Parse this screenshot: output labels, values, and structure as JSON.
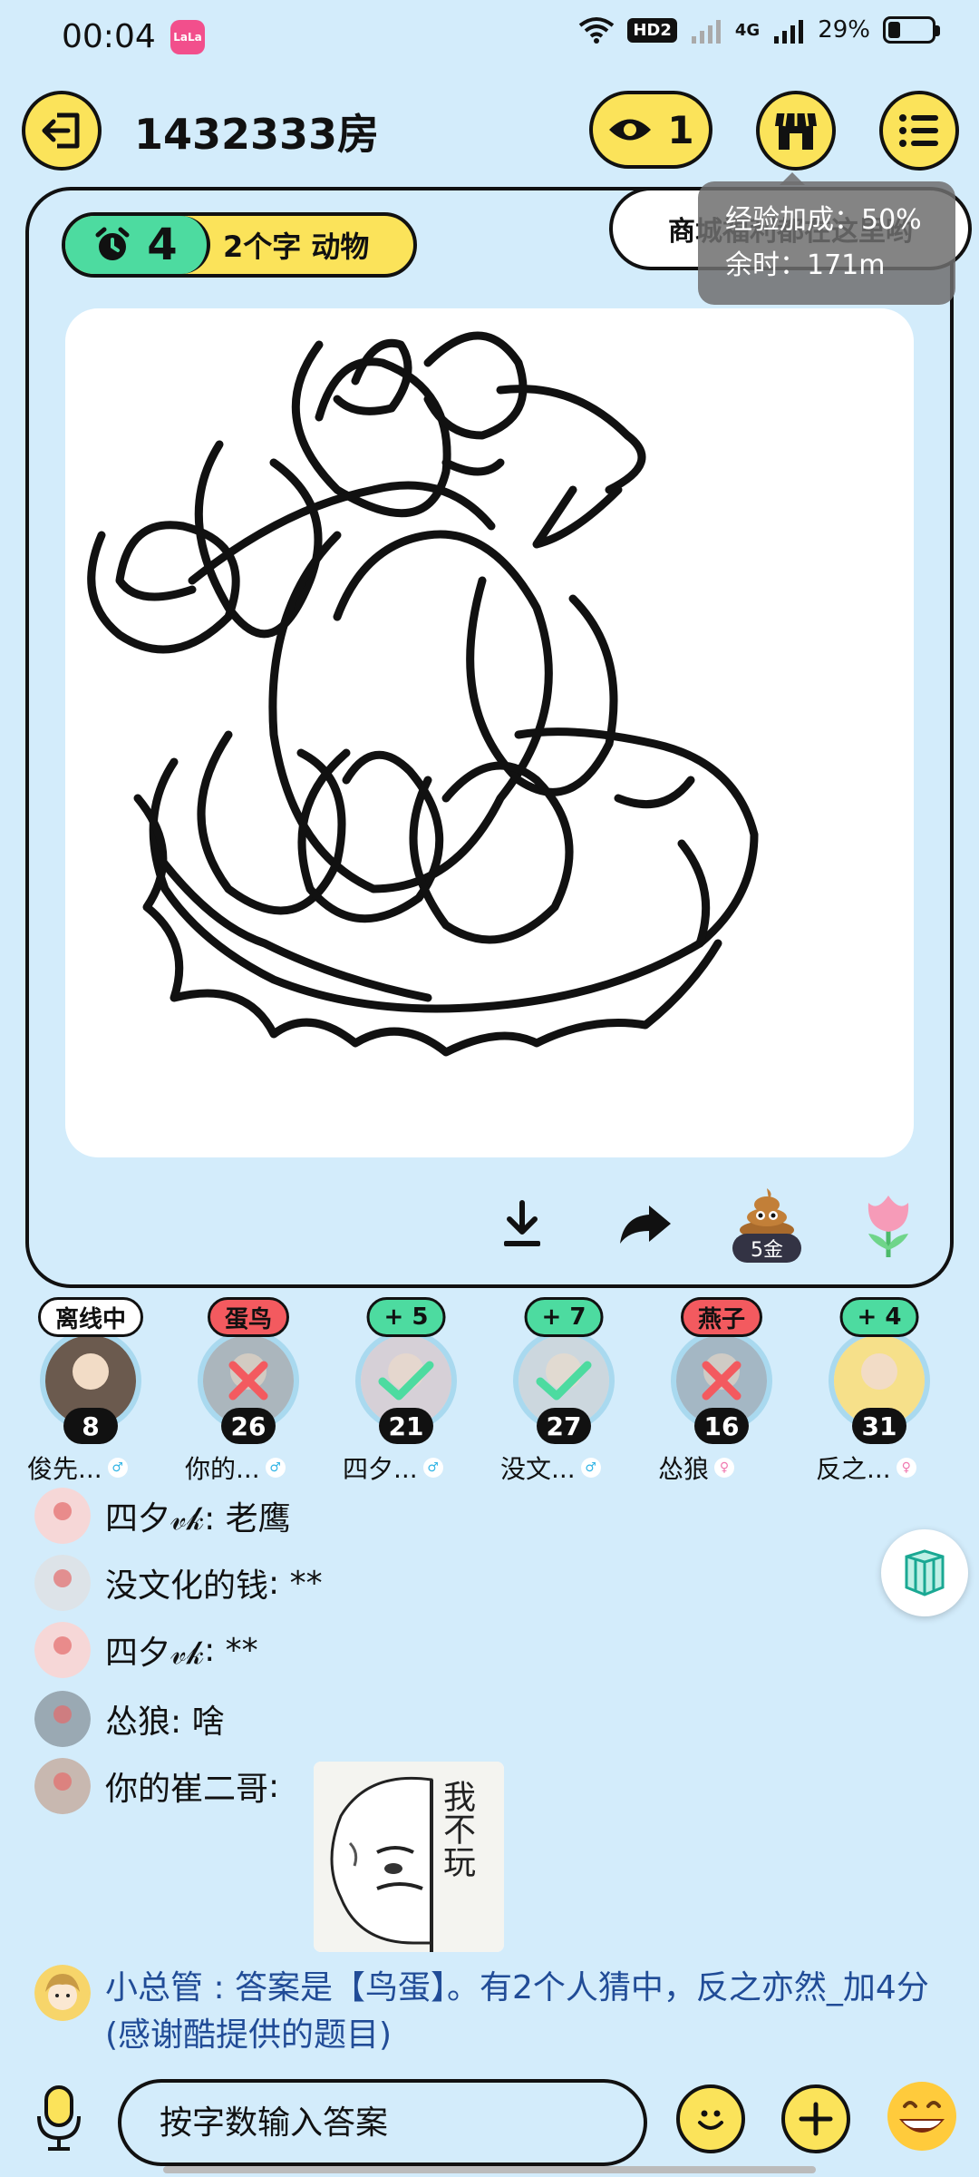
{
  "status": {
    "time": "00:04",
    "app_icon_text": "LaLa",
    "hd": "HD2",
    "network": "4G",
    "battery": "29%",
    "battery_level": 0.29
  },
  "header": {
    "room_title": "1432333房",
    "viewer_count": "1"
  },
  "game": {
    "timer": "4",
    "hint": "2个字 动物",
    "tip_bubble": "商城福利都在这里哟",
    "tooltip_line1": "经验加成：50%",
    "tooltip_line2": "余时：171m",
    "poop_cost": "5金"
  },
  "players": [
    {
      "badge": "离线中",
      "badge_type": "offline",
      "score": "8",
      "name": "俊先...",
      "gender": "male",
      "mark": "none",
      "avatar_color": "#6b5a4e"
    },
    {
      "badge": "蛋鸟",
      "badge_type": "red",
      "score": "26",
      "name": "你的...",
      "gender": "male",
      "mark": "wrong",
      "avatar_color": "#8a8a8a"
    },
    {
      "badge": "+ 5",
      "badge_type": "green",
      "score": "21",
      "name": "四夕...",
      "gender": "male",
      "mark": "correct",
      "avatar_color": "#d9b9b9"
    },
    {
      "badge": "+ 7",
      "badge_type": "green",
      "score": "27",
      "name": "没文...",
      "gender": "male",
      "mark": "correct",
      "avatar_color": "#c6c6c6"
    },
    {
      "badge": "燕子",
      "badge_type": "red",
      "score": "16",
      "name": "怂狼",
      "gender": "female",
      "mark": "wrong",
      "avatar_color": "#7d8c97"
    },
    {
      "badge": "+ 4",
      "badge_type": "green",
      "score": "31",
      "name": "反之...",
      "gender": "female",
      "mark": "none",
      "avatar_color": "#f6e08a"
    }
  ],
  "chat": [
    {
      "sender": "四夕𝓋𝓀",
      "text": " : 老鹰"
    },
    {
      "sender": "没文化的钱",
      "text": " : **"
    },
    {
      "sender": "四夕𝓋𝓀",
      "text": " : **"
    },
    {
      "sender": "怂狼",
      "text": " : 啥"
    },
    {
      "sender": "你的崔二哥",
      "text": " :"
    }
  ],
  "sticker_text": "我不玩",
  "system_message": "小总管 : 答案是【鸟蛋】。有2个人猜中，反之亦然_加4分(感谢酷提供的题目)",
  "input": {
    "placeholder": "按字数输入答案"
  },
  "colors": {
    "background": "#d3ecfb",
    "yellow": "#fbe35a",
    "green": "#4ddba0",
    "red": "#f35a5f",
    "system_text": "#214c97"
  }
}
